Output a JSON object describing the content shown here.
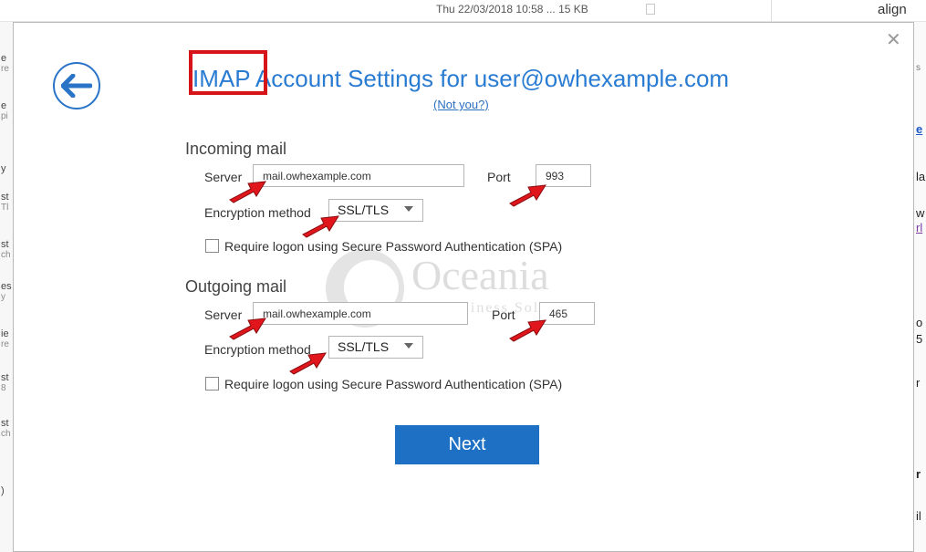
{
  "background": {
    "file_meta": "Thu 22/03/2018 10:58 ...   15 KB",
    "top_right_text": "align",
    "left_fragments": [
      {
        "a": "e",
        "b": "re"
      },
      {
        "a": "e",
        "b": "pi"
      },
      {
        "a": "y",
        "b": ""
      },
      {
        "a": "st",
        "b": "Tl"
      },
      {
        "a": "st",
        "b": "ch"
      },
      {
        "a": "es",
        "b": "y"
      },
      {
        "a": "ie",
        "b": "re"
      },
      {
        "a": "st",
        "b": "8"
      },
      {
        "a": "st",
        "b": "ch"
      },
      {
        "a": ")",
        "b": ""
      }
    ],
    "right_fragments": {
      "f1": "s",
      "f2": "e",
      "f3": "la",
      "f4": "w",
      "f5": "rl",
      "f6": "o",
      "f7": "5",
      "f8": "r",
      "f9": "r",
      "f10": "il"
    }
  },
  "dialog": {
    "title_prefix": "IMAP",
    "title_rest": " Account Settings for user@owhexample.com",
    "not_you": "(Not you?)",
    "incoming": {
      "heading": "Incoming mail",
      "server_label": "Server",
      "server_value": "mail.owhexample.com",
      "port_label": "Port",
      "port_value": "993",
      "encryption_label": "Encryption method",
      "encryption_value": "SSL/TLS",
      "spa_label": "Require logon using Secure Password Authentication (SPA)",
      "spa_checked": false
    },
    "outgoing": {
      "heading": "Outgoing mail",
      "server_label": "Server",
      "server_value": "mail.owhexample.com",
      "port_label": "Port",
      "port_value": "465",
      "encryption_label": "Encryption method",
      "encryption_value": "SSL/TLS",
      "spa_label": "Require logon using Secure Password Authentication (SPA)",
      "spa_checked": false
    },
    "next_label": "Next"
  },
  "watermark": {
    "name": "Oceania",
    "tagline": "Business Solutions"
  },
  "colors": {
    "accent": "#1e70c4",
    "title": "#2a7bd2",
    "highlight_box": "#d6151b",
    "annotation_arrow": "#e0161c"
  },
  "icons": {
    "back": "back-arrow-icon",
    "close": "close-icon",
    "dropdown": "chevron-down-icon",
    "annotation": "red-arrow-icon"
  }
}
